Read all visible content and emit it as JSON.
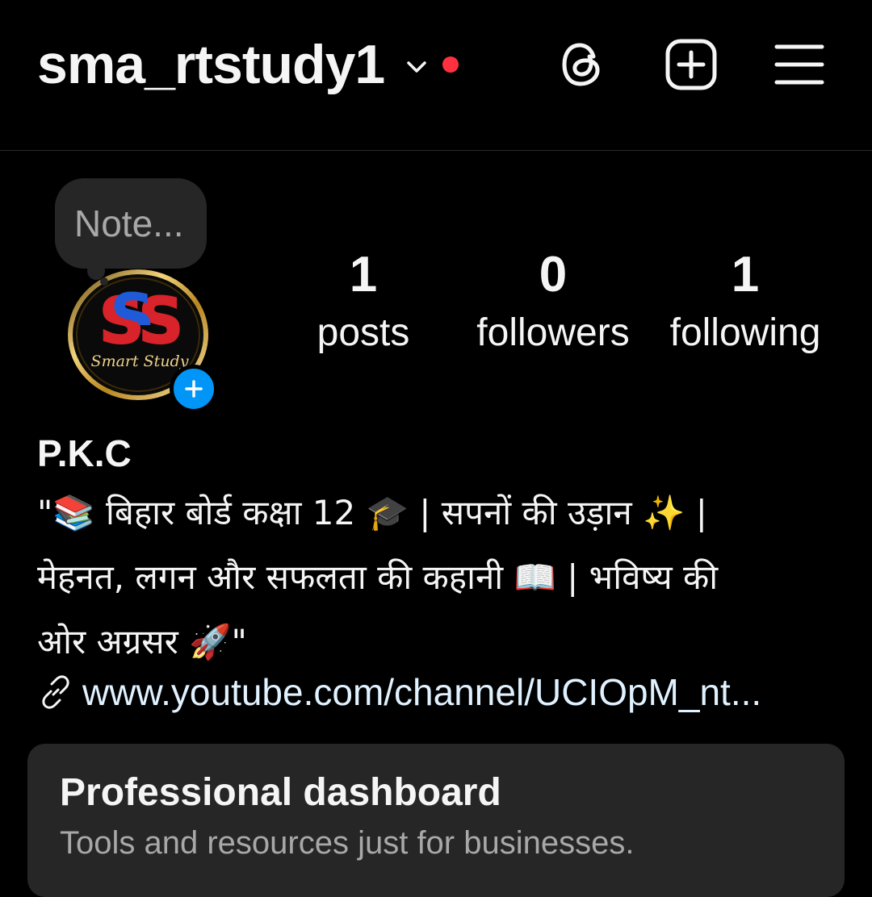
{
  "header": {
    "username": "sma_rtstudy1",
    "notification_dot_color": "#ff3040",
    "icons": [
      "chevron-down-icon",
      "threads-icon",
      "create-plus-icon",
      "hamburger-menu-icon"
    ]
  },
  "note": {
    "placeholder": "Note..."
  },
  "avatar": {
    "logo_letters": "SS",
    "logo_script": "Smart Study",
    "add_story_color": "#0095f6"
  },
  "stats": {
    "posts": {
      "count": "1",
      "label": "posts"
    },
    "followers": {
      "count": "0",
      "label": "followers"
    },
    "following": {
      "count": "1",
      "label": "following"
    }
  },
  "profile": {
    "name": "P.K.C",
    "bio_lines": [
      "\"📚 बिहार बोर्ड कक्षा 12 🎓 | सपनों की उड़ान ✨ |",
      "मेहनत, लगन और सफलता की कहानी 📖 | भविष्य की",
      "ओर अग्रसर 🚀\""
    ],
    "link": "www.youtube.com/channel/UCIOpM_nt..."
  },
  "dashboard": {
    "title": "Professional dashboard",
    "subtitle": "Tools and resources just for businesses."
  }
}
